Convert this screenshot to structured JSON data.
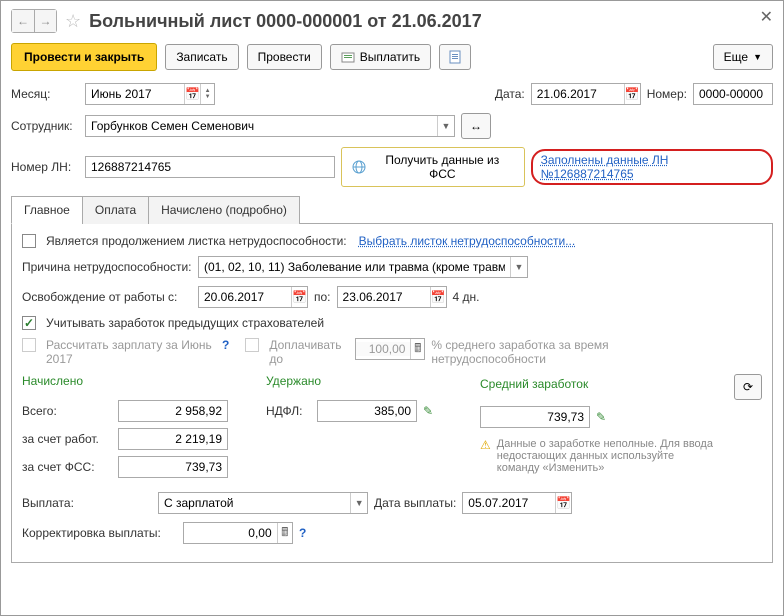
{
  "title": "Больничный лист 0000-000001 от 21.06.2017",
  "toolbar": {
    "post_close": "Провести и закрыть",
    "write": "Записать",
    "post": "Провести",
    "pay": "Выплатить",
    "more": "Еще"
  },
  "header": {
    "month_label": "Месяц:",
    "month": "Июнь 2017",
    "date_label": "Дата:",
    "date": "21.06.2017",
    "number_label": "Номер:",
    "number": "0000-00000",
    "employee_label": "Сотрудник:",
    "employee": "Горбунков Семен Семенович",
    "ln_label": "Номер ЛН:",
    "ln_number": "126887214765",
    "get_fss": "Получить данные из ФСС",
    "filled_link": "Заполнены данные ЛН №126887214765"
  },
  "tabs": {
    "main": "Главное",
    "pay": "Оплата",
    "accr": "Начислено (подробно)"
  },
  "main": {
    "continuation": "Является продолжением листка нетрудоспособности:",
    "choose_sheet": "Выбрать листок нетрудоспособности...",
    "reason_label": "Причина нетрудоспособности:",
    "reason": "(01, 02, 10, 11) Заболевание или травма (кроме травм",
    "release_label": "Освобождение от работы с:",
    "release_from": "20.06.2017",
    "release_to_label": "по:",
    "release_to": "23.06.2017",
    "days": "4 дн.",
    "prev_insurers": "Учитывать заработок предыдущих страхователей",
    "calc_salary": "Рассчитать зарплату за Июнь 2017",
    "extra_pay": "Доплачивать до",
    "percent": "100,00",
    "percent_note": "% среднего заработка за время нетрудоспособности",
    "accrued_h": "Начислено",
    "withheld_h": "Удержано",
    "avg_h": "Средний заработок",
    "total_label": "Всего:",
    "total": "2 958,92",
    "ndfl_label": "НДФЛ:",
    "ndfl": "385,00",
    "avg": "739,73",
    "employer_label": "за счет работ.",
    "employer": "2 219,19",
    "fss_label": "за счет ФСС:",
    "fss": "739,73",
    "warn": "Данные о заработке неполные. Для ввода недостающих данных используйте команду «Изменить»",
    "payment_label": "Выплата:",
    "payment_type": "С зарплатой",
    "payment_date_label": "Дата выплаты:",
    "payment_date": "05.07.2017",
    "corr_label": "Корректировка выплаты:",
    "corr": "0,00"
  }
}
